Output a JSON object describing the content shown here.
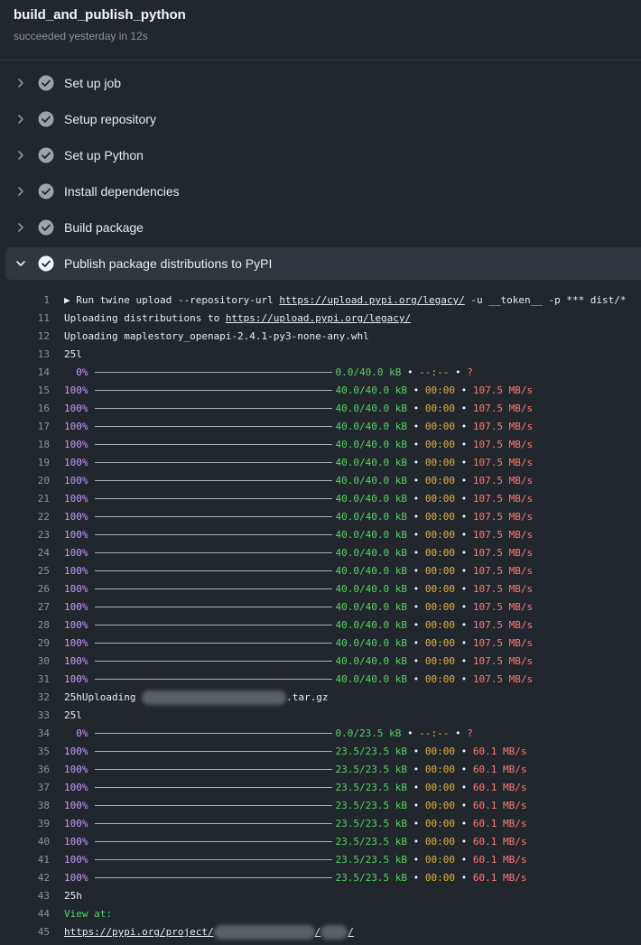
{
  "job": {
    "title": "build_and_publish_python",
    "subtitle": "succeeded yesterday in 12s"
  },
  "steps": [
    {
      "label": "Set up job",
      "expanded": false
    },
    {
      "label": "Setup repository",
      "expanded": false
    },
    {
      "label": "Set up Python",
      "expanded": false
    },
    {
      "label": "Install dependencies",
      "expanded": false
    },
    {
      "label": "Build package",
      "expanded": false
    },
    {
      "label": "Publish package distributions to PyPI",
      "expanded": true
    }
  ],
  "log": [
    {
      "n": "1",
      "kind": "cmd",
      "prefix": "▶ Run twine upload --repository-url ",
      "url": "https://upload.pypi.org/legacy/",
      "suffix": " -u __token__ -p *** dist/*"
    },
    {
      "n": "11",
      "kind": "link",
      "prefix": "Uploading distributions to ",
      "url": "https://upload.pypi.org/legacy/",
      "suffix": ""
    },
    {
      "n": "12",
      "kind": "text",
      "text": "Uploading maplestory_openapi-2.4.1-py3-none-any.whl"
    },
    {
      "n": "13",
      "kind": "text",
      "text": "25l"
    },
    {
      "n": "14",
      "kind": "progress",
      "pct": "  0%",
      "size": "0.0/40.0 kB",
      "eta": "--:--",
      "speed": "?"
    },
    {
      "n": "15",
      "kind": "progress",
      "pct": "100%",
      "size": "40.0/40.0 kB",
      "eta": "00:00",
      "speed": "107.5 MB/s"
    },
    {
      "n": "16",
      "kind": "progress",
      "pct": "100%",
      "size": "40.0/40.0 kB",
      "eta": "00:00",
      "speed": "107.5 MB/s"
    },
    {
      "n": "17",
      "kind": "progress",
      "pct": "100%",
      "size": "40.0/40.0 kB",
      "eta": "00:00",
      "speed": "107.5 MB/s"
    },
    {
      "n": "18",
      "kind": "progress",
      "pct": "100%",
      "size": "40.0/40.0 kB",
      "eta": "00:00",
      "speed": "107.5 MB/s"
    },
    {
      "n": "19",
      "kind": "progress",
      "pct": "100%",
      "size": "40.0/40.0 kB",
      "eta": "00:00",
      "speed": "107.5 MB/s"
    },
    {
      "n": "20",
      "kind": "progress",
      "pct": "100%",
      "size": "40.0/40.0 kB",
      "eta": "00:00",
      "speed": "107.5 MB/s"
    },
    {
      "n": "21",
      "kind": "progress",
      "pct": "100%",
      "size": "40.0/40.0 kB",
      "eta": "00:00",
      "speed": "107.5 MB/s"
    },
    {
      "n": "22",
      "kind": "progress",
      "pct": "100%",
      "size": "40.0/40.0 kB",
      "eta": "00:00",
      "speed": "107.5 MB/s"
    },
    {
      "n": "23",
      "kind": "progress",
      "pct": "100%",
      "size": "40.0/40.0 kB",
      "eta": "00:00",
      "speed": "107.5 MB/s"
    },
    {
      "n": "24",
      "kind": "progress",
      "pct": "100%",
      "size": "40.0/40.0 kB",
      "eta": "00:00",
      "speed": "107.5 MB/s"
    },
    {
      "n": "25",
      "kind": "progress",
      "pct": "100%",
      "size": "40.0/40.0 kB",
      "eta": "00:00",
      "speed": "107.5 MB/s"
    },
    {
      "n": "26",
      "kind": "progress",
      "pct": "100%",
      "size": "40.0/40.0 kB",
      "eta": "00:00",
      "speed": "107.5 MB/s"
    },
    {
      "n": "27",
      "kind": "progress",
      "pct": "100%",
      "size": "40.0/40.0 kB",
      "eta": "00:00",
      "speed": "107.5 MB/s"
    },
    {
      "n": "28",
      "kind": "progress",
      "pct": "100%",
      "size": "40.0/40.0 kB",
      "eta": "00:00",
      "speed": "107.5 MB/s"
    },
    {
      "n": "29",
      "kind": "progress",
      "pct": "100%",
      "size": "40.0/40.0 kB",
      "eta": "00:00",
      "speed": "107.5 MB/s"
    },
    {
      "n": "30",
      "kind": "progress",
      "pct": "100%",
      "size": "40.0/40.0 kB",
      "eta": "00:00",
      "speed": "107.5 MB/s"
    },
    {
      "n": "31",
      "kind": "progress",
      "pct": "100%",
      "size": "40.0/40.0 kB",
      "eta": "00:00",
      "speed": "107.5 MB/s"
    },
    {
      "n": "32",
      "kind": "blurred",
      "prefix": "25hUploading ",
      "suffix": ".tar.gz"
    },
    {
      "n": "33",
      "kind": "text",
      "text": "25l"
    },
    {
      "n": "34",
      "kind": "progress",
      "pct": "  0%",
      "size": "0.0/23.5 kB",
      "eta": "--:--",
      "speed": "?"
    },
    {
      "n": "35",
      "kind": "progress",
      "pct": "100%",
      "size": "23.5/23.5 kB",
      "eta": "00:00",
      "speed": "60.1 MB/s"
    },
    {
      "n": "36",
      "kind": "progress",
      "pct": "100%",
      "size": "23.5/23.5 kB",
      "eta": "00:00",
      "speed": "60.1 MB/s"
    },
    {
      "n": "37",
      "kind": "progress",
      "pct": "100%",
      "size": "23.5/23.5 kB",
      "eta": "00:00",
      "speed": "60.1 MB/s"
    },
    {
      "n": "38",
      "kind": "progress",
      "pct": "100%",
      "size": "23.5/23.5 kB",
      "eta": "00:00",
      "speed": "60.1 MB/s"
    },
    {
      "n": "39",
      "kind": "progress",
      "pct": "100%",
      "size": "23.5/23.5 kB",
      "eta": "00:00",
      "speed": "60.1 MB/s"
    },
    {
      "n": "40",
      "kind": "progress",
      "pct": "100%",
      "size": "23.5/23.5 kB",
      "eta": "00:00",
      "speed": "60.1 MB/s"
    },
    {
      "n": "41",
      "kind": "progress",
      "pct": "100%",
      "size": "23.5/23.5 kB",
      "eta": "00:00",
      "speed": "60.1 MB/s"
    },
    {
      "n": "42",
      "kind": "progress",
      "pct": "100%",
      "size": "23.5/23.5 kB",
      "eta": "00:00",
      "speed": "60.1 MB/s"
    },
    {
      "n": "43",
      "kind": "text",
      "text": "25h"
    },
    {
      "n": "44",
      "kind": "green",
      "text": "View at:"
    },
    {
      "n": "45",
      "kind": "blurlink",
      "prefix": "https://pypi.org/project/",
      "mid": "/",
      "suffix": "/"
    }
  ],
  "colors": {
    "background": "#22262d",
    "green": "#56d364",
    "yellow": "#e3b341",
    "red": "#ff7b72",
    "purple": "#c79bff"
  }
}
